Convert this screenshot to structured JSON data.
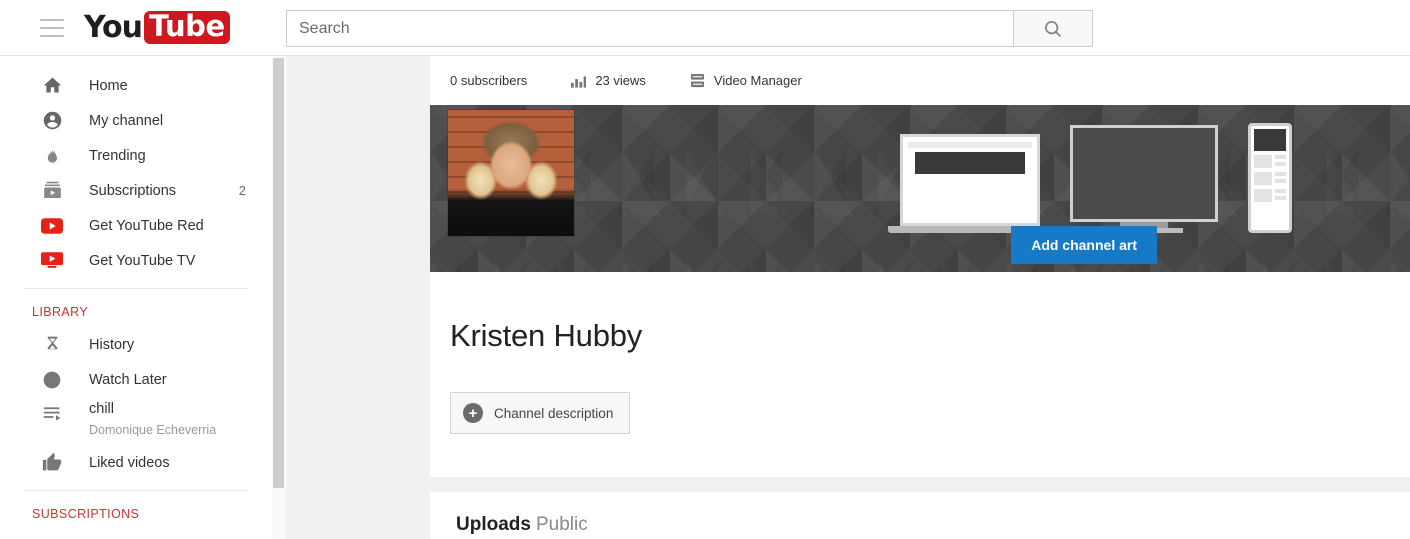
{
  "header": {
    "menu_icon": "hamburger-icon",
    "logo_you": "You",
    "logo_tube": "Tube",
    "search": {
      "placeholder": "Search",
      "value": "",
      "button_icon": "search-icon"
    }
  },
  "sidebar": {
    "items": [
      {
        "label": "Home",
        "icon": "home-icon",
        "badge": ""
      },
      {
        "label": "My channel",
        "icon": "account-circle-icon",
        "badge": ""
      },
      {
        "label": "Trending",
        "icon": "flame-icon",
        "badge": ""
      },
      {
        "label": "Subscriptions",
        "icon": "subscriptions-icon",
        "badge": "2"
      },
      {
        "label": "Get YouTube Red",
        "icon": "youtube-red-icon",
        "badge": ""
      },
      {
        "label": "Get YouTube TV",
        "icon": "youtube-tv-icon",
        "badge": ""
      }
    ],
    "library_header": "LIBRARY",
    "library_items": [
      {
        "label": "History",
        "icon": "hourglass-icon",
        "sub": ""
      },
      {
        "label": "Watch Later",
        "icon": "clock-icon",
        "sub": ""
      },
      {
        "label": "chill",
        "icon": "playlist-icon",
        "sub": "Domonique Echeverria"
      },
      {
        "label": "Liked videos",
        "icon": "thumb-up-icon",
        "sub": ""
      }
    ],
    "subscriptions_header": "SUBSCRIPTIONS"
  },
  "channel": {
    "stats": {
      "subscribers": "0 subscribers",
      "views": "23 views",
      "views_icon": "analytics-bars-icon",
      "video_manager": "Video Manager",
      "video_manager_icon": "video-manager-icon"
    },
    "banner": {
      "add_channel_art": "Add channel art",
      "avatar_alt": "channel-avatar-photo",
      "devices": [
        "laptop-mockup",
        "tv-mockup",
        "phone-mockup"
      ],
      "accent_blue": "#167ac6"
    },
    "title": "Kristen Hubby",
    "description_button": {
      "label": "Channel description",
      "icon": "plus-circle-icon"
    }
  },
  "uploads": {
    "title": "Uploads",
    "privacy": "Public"
  }
}
